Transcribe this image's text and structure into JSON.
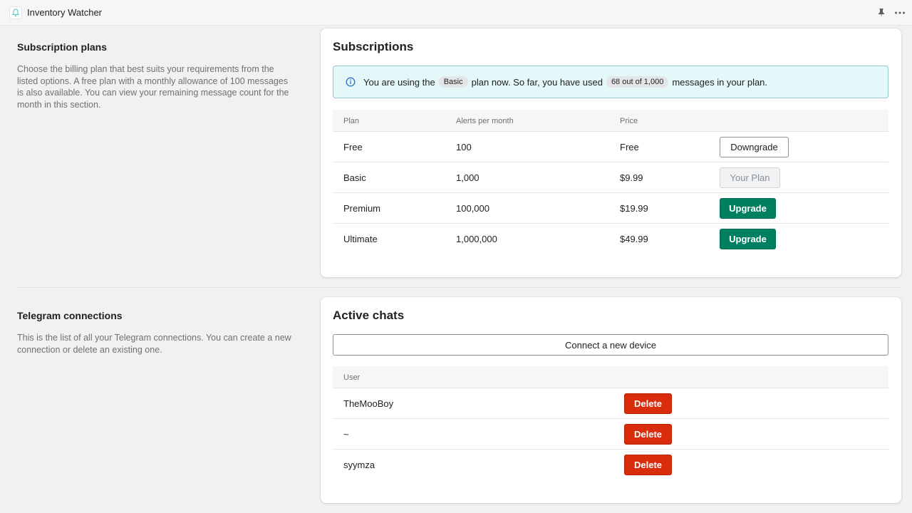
{
  "app": {
    "title": "Inventory Watcher",
    "icon": "bell-icon",
    "accent_color": "#008060",
    "danger_color": "#d82c0d"
  },
  "subscriptions_section": {
    "heading": "Subscription plans",
    "description": "Choose the billing plan that best suits your requirements from the listed options. A free plan with a monthly allowance of 100 messages is also available. You can view your remaining message count for the month in this section."
  },
  "subscriptions_card": {
    "title": "Subscriptions",
    "banner": {
      "icon": "info-icon",
      "text_1": "You are using the",
      "plan_pill": "Basic",
      "text_2": "plan now. So far, you have used",
      "usage_pill": "68 out of 1,000",
      "text_3": "messages in your plan."
    },
    "table": {
      "headers": [
        "Plan",
        "Alerts per month",
        "Price"
      ],
      "rows": [
        {
          "plan": "Free",
          "alerts": "100",
          "price": "Free",
          "action": "Downgrade"
        },
        {
          "plan": "Basic",
          "alerts": "1,000",
          "price": "$9.99",
          "action": "Your Plan"
        },
        {
          "plan": "Premium",
          "alerts": "100,000",
          "price": "$19.99",
          "action": "Upgrade"
        },
        {
          "plan": "Ultimate",
          "alerts": "1,000,000",
          "price": "$49.99",
          "action": "Upgrade"
        }
      ]
    }
  },
  "telegram_section": {
    "heading": "Telegram connections",
    "description": "This is the list of all your Telegram connections. You can create a new connection or delete an existing one."
  },
  "chats_card": {
    "title": "Active chats",
    "connect_label": "Connect a new device",
    "table": {
      "headers": [
        "User"
      ],
      "rows": [
        {
          "user": "TheMooBoy",
          "action": "Delete"
        },
        {
          "user": "~",
          "action": "Delete"
        },
        {
          "user": "syymza",
          "action": "Delete"
        }
      ]
    }
  }
}
